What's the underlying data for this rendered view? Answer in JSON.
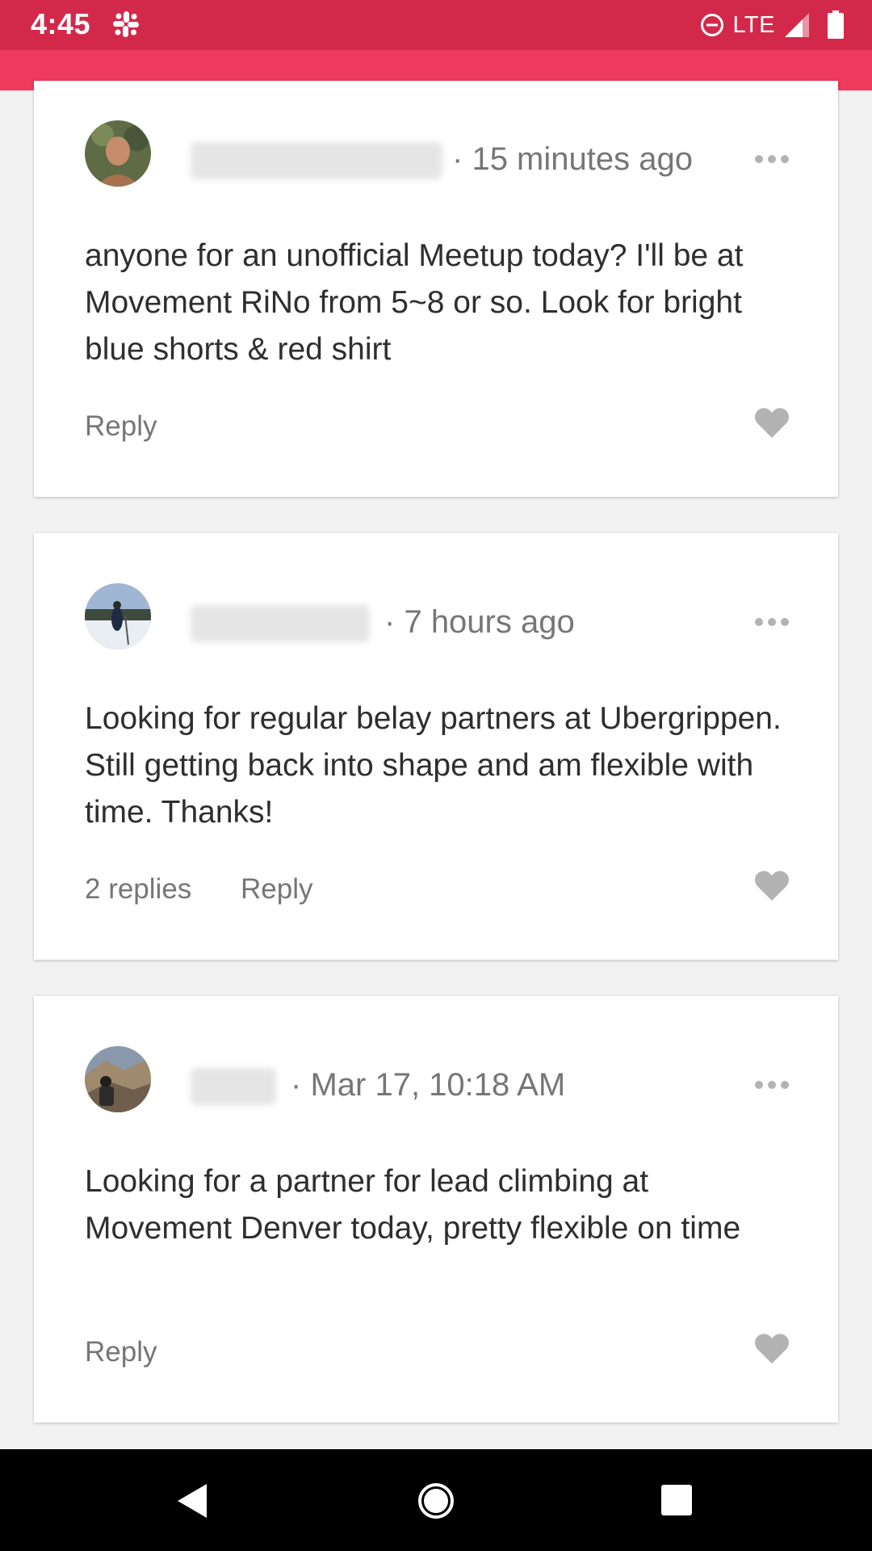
{
  "status_bar": {
    "time": "4:45",
    "network": "LTE",
    "icons": [
      "slack-icon",
      "do-not-disturb-icon",
      "signal-icon",
      "battery-icon"
    ],
    "background": "#d2294b"
  },
  "header": {
    "background": "#ee3a5c"
  },
  "posts": [
    {
      "time": "15 minutes ago",
      "body": "anyone for an unofficial Meetup today? I'll be at Movement RiNo from 5~8 or so.  Look for bright blue shorts & red shirt",
      "replies_label": "",
      "reply_label": "Reply",
      "author_blurred": true
    },
    {
      "time": "7 hours ago",
      "body": "Looking for regular belay partners at Ubergrippen. Still getting back into shape and am flexible with time. Thanks!",
      "replies_label": "2 replies",
      "reply_label": "Reply",
      "author_blurred": true
    },
    {
      "time": "Mar 17, 10:18 AM",
      "body": "Looking for a partner for lead climbing at Movement Denver today, pretty flexible on time",
      "replies_label": "",
      "reply_label": "Reply",
      "author_blurred": true
    }
  ],
  "meta_separator": "·",
  "colors": {
    "card_background": "#ffffff",
    "page_background": "#f2f2f2",
    "muted_text": "#767676",
    "body_text": "#2e2e2e",
    "icon_gray": "#b3b3b3"
  },
  "nav_bar": {
    "buttons": [
      "back-icon",
      "home-icon",
      "recents-icon"
    ]
  }
}
